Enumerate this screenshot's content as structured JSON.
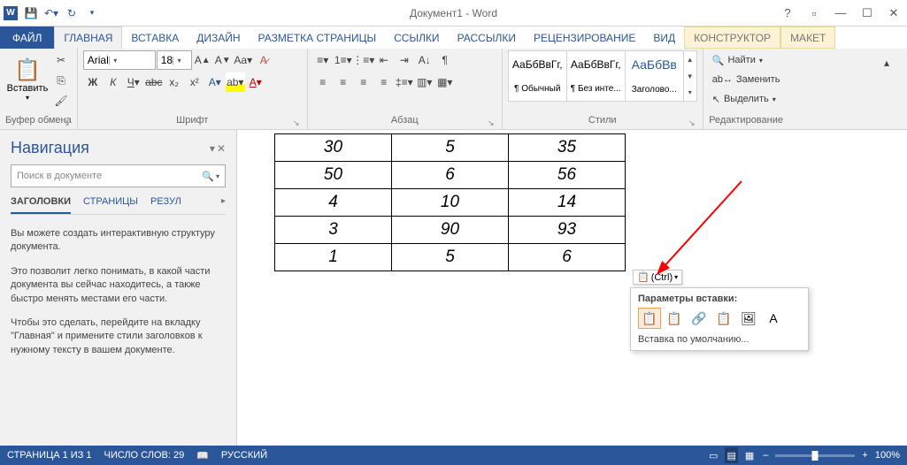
{
  "title": "Документ1 - Word",
  "qat": {
    "save": "💾",
    "undo": "↶",
    "redo": "↻"
  },
  "tabs": {
    "file": "ФАЙЛ",
    "items": [
      "ГЛАВНАЯ",
      "ВСТАВКА",
      "ДИЗАЙН",
      "РАЗМЕТКА СТРАНИЦЫ",
      "ССЫЛКИ",
      "РАССЫЛКИ",
      "РЕЦЕНЗИРОВАНИЕ",
      "ВИД"
    ],
    "ctx": [
      "КОНСТРУКТОР",
      "МАКЕТ"
    ]
  },
  "ribbon": {
    "clipboard": {
      "label": "Буфер обмена",
      "paste": "Вставить"
    },
    "font": {
      "label": "Шрифт",
      "name": "Arial",
      "size": "18"
    },
    "paragraph": {
      "label": "Абзац"
    },
    "styles": {
      "label": "Стили",
      "tiles": [
        {
          "sample": "АаБбВвГг,",
          "name": "¶ Обычный",
          "color": "#000"
        },
        {
          "sample": "АаБбВвГг,",
          "name": "¶ Без инте...",
          "color": "#000"
        },
        {
          "sample": "АаБбВв",
          "name": "Заголово...",
          "color": "#2b579a"
        }
      ]
    },
    "editing": {
      "label": "Редактирование",
      "find": "Найти",
      "replace": "Заменить",
      "select": "Выделить"
    }
  },
  "nav": {
    "title": "Навигация",
    "search_ph": "Поиск в документе",
    "tabs": [
      "ЗАГОЛОВКИ",
      "СТРАНИЦЫ",
      "РЕЗУЛ"
    ],
    "p1": "Вы можете создать интерактивную структуру документа.",
    "p2": "Это позволит легко понимать, в какой части документа вы сейчас находитесь, а также быстро менять местами его части.",
    "p3": "Чтобы это сделать, перейдите на вкладку \"Главная\" и примените стили заголовков к нужному тексту в вашем документе."
  },
  "table": {
    "rows": [
      [
        "30",
        "5",
        "35"
      ],
      [
        "50",
        "6",
        "56"
      ],
      [
        "4",
        "10",
        "14"
      ],
      [
        "3",
        "90",
        "93"
      ],
      [
        "1",
        "5",
        "6"
      ]
    ]
  },
  "ctrl_tag": "(Ctrl)",
  "paste_fly": {
    "hdr": "Параметры вставки:",
    "def": "Вставка по умолчанию..."
  },
  "status": {
    "page": "СТРАНИЦА 1 ИЗ 1",
    "words": "ЧИСЛО СЛОВ: 29",
    "lang": "РУССКИЙ",
    "zoom": "100%"
  }
}
